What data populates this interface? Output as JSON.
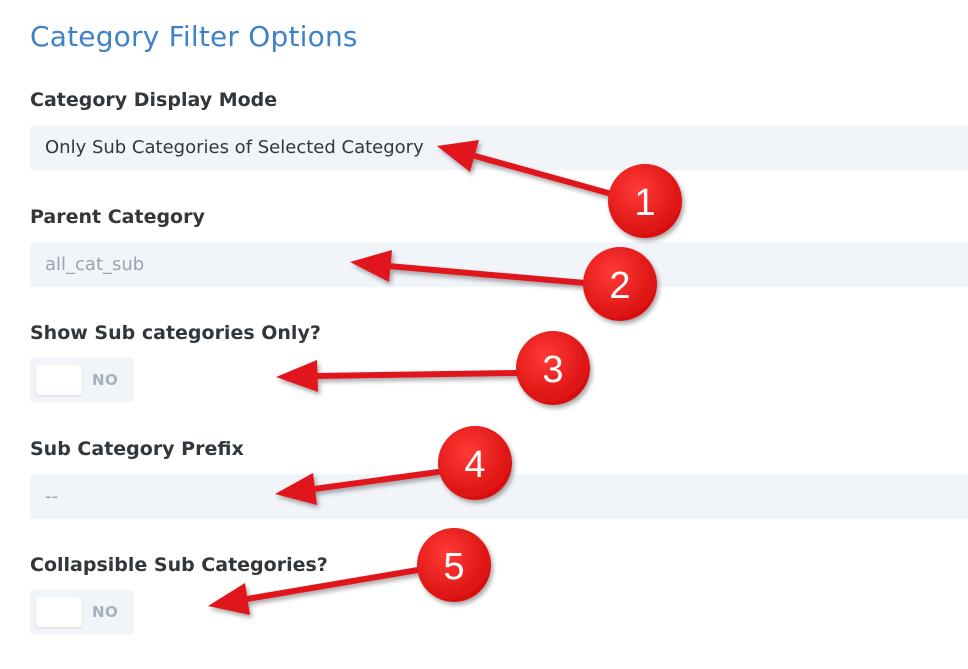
{
  "section": {
    "title": "Category Filter Options"
  },
  "fields": {
    "display_mode": {
      "label": "Category Display Mode",
      "value": "Only Sub Categories of Selected Category"
    },
    "parent_category": {
      "label": "Parent Category",
      "placeholder": "all_cat_sub"
    },
    "show_sub_only": {
      "label": "Show Sub categories Only?",
      "state": "NO"
    },
    "sub_prefix": {
      "label": "Sub Category Prefix",
      "placeholder": "--"
    },
    "collapsible": {
      "label": "Collapsible Sub Categories?",
      "state": "NO"
    }
  },
  "annotations": {
    "arrow_color": "#e0191a",
    "markers": [
      "1",
      "2",
      "3",
      "4",
      "5"
    ]
  }
}
